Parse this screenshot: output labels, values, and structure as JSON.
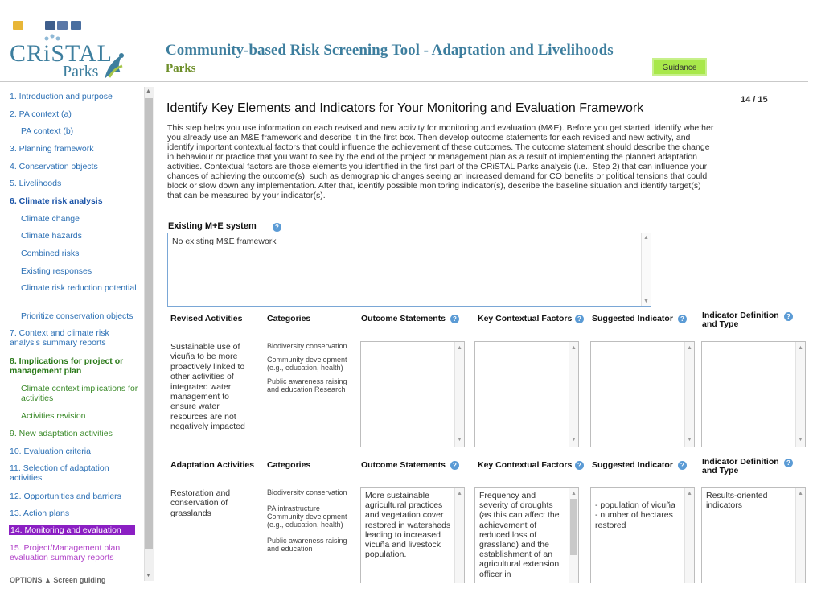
{
  "app": {
    "logo_text": "CRiSTAL",
    "logo_sub": "Parks",
    "title": "Community-based Risk Screening Tool - Adaptation and Livelihoods",
    "subtitle": "Parks",
    "guidance_label": "Guidance"
  },
  "toolbar": {
    "icons": [
      "folder-open-icon",
      "save-icon",
      "edit-icon",
      "print-icon"
    ]
  },
  "sidebar": {
    "items": [
      {
        "label": "1. Introduction and purpose"
      },
      {
        "label": "2. PA context (a)"
      },
      {
        "label": "PA context (b)"
      },
      {
        "label": "3. Planning framework"
      },
      {
        "label": "4. Conservation objects"
      },
      {
        "label": "5. Livelihoods"
      },
      {
        "label": "6. Climate risk analysis"
      },
      {
        "label": "Climate change"
      },
      {
        "label": "Climate hazards"
      },
      {
        "label": "Combined risks"
      },
      {
        "label": "Existing responses"
      },
      {
        "label": "Climate risk reduction potential"
      },
      {
        "label": "Prioritize conservation objects"
      },
      {
        "label": "7. Context and climate risk analysis summary reports"
      },
      {
        "label": "8. Implications for project or management plan"
      },
      {
        "label": "Climate context implications for activities"
      },
      {
        "label": "Activities revision"
      },
      {
        "label": "9. New adaptation activities"
      },
      {
        "label": "10. Evaluation criteria"
      },
      {
        "label": "11. Selection of adaptation activities"
      },
      {
        "label": "12. Opportunities and barriers"
      },
      {
        "label": "13. Action plans"
      },
      {
        "label": "14. Monitoring and evaluation"
      },
      {
        "label": "15. Project/Management plan evaluation summary reports"
      }
    ],
    "active_item": "14. Monitoring and evaluation",
    "bottom_label": "OPTIONS  ▲  Screen guiding"
  },
  "page": {
    "counter": "14 / 15",
    "heading": "Identify Key Elements and Indicators for Your Monitoring and Evaluation Framework",
    "intro": "This step helps you use information on each revised and new activity for monitoring and evaluation (M&E). Before you get started, identify whether you already use an M&E framework and describe it in the first box. Then develop outcome statements for each revised and new activity, and identify important contextual factors that could influence the achievement of these outcomes. The outcome statement should describe the change in behaviour or practice that you want to see by the end of the project or management plan as a result of implementing the planned adaptation activities. Contextual factors are those elements you identified in the first part of the CRiSTAL Parks analysis (i.e., Step 2) that can influence your chances of achieving the outcome(s), such as demographic changes seeing an increased demand for CO benefits or political tensions that could block or slow down any implementation. After that, identify possible monitoring indicator(s), describe the baseline situation and identify target(s) that can be measured by your indicator(s).",
    "existing_mne_label": "Existing M+E system",
    "existing_mne_value": "No existing M&E framework"
  },
  "revised_section": {
    "headers": {
      "activities": "Revised Activities",
      "categories": "Categories",
      "outcome": "Outcome Statements",
      "contextual": "Key Contextual Factors",
      "indicator": "Suggested Indicator",
      "definition": "Indicator Definition and Type"
    },
    "row": {
      "activity": "Sustainable use of vicuña to be more proactively linked to other activities of integrated water management to ensure water resources are not negatively impacted",
      "categories": [
        "Biodiversity conservation",
        "Community development (e.g., education, health)",
        "Public awareness raising and education Research"
      ],
      "outcome": "",
      "contextual": "",
      "indicator": "",
      "definition": ""
    }
  },
  "adaptation_section": {
    "headers": {
      "activities": "Adaptation Activities",
      "categories": "Categories",
      "outcome": "Outcome Statements",
      "contextual": "Key Contextual Factors",
      "indicator": "Suggested Indicator",
      "definition": "Indicator Definition and Type"
    },
    "row": {
      "activity": "Restoration and conservation of grasslands",
      "categories": [
        "Biodiversity conservation",
        "PA infrastructure Community development (e.g., education, health)",
        "Public awareness raising and education"
      ],
      "outcome": "More sustainable agricultural practices and vegetation cover restored in watersheds leading to increased vicuña and livestock population.",
      "contextual": "Frequency and severity of droughts (as this can affect the achievement of reduced loss of grassland) and the establishment of an agricultural extension officer in",
      "indicator": "- population of vicuña\n- number of hectares restored",
      "definition": "Results-oriented indicators"
    }
  },
  "colors": {
    "brand": "#3d7e9e",
    "brand_green": "#6e8f2a",
    "guidance_bg": "#a8e84a",
    "nav_link": "#2b6fb4",
    "nav_active_bg": "#8b1fc3",
    "nav_green": "#3b8a2a",
    "help_icon": "#5b9bd5"
  }
}
